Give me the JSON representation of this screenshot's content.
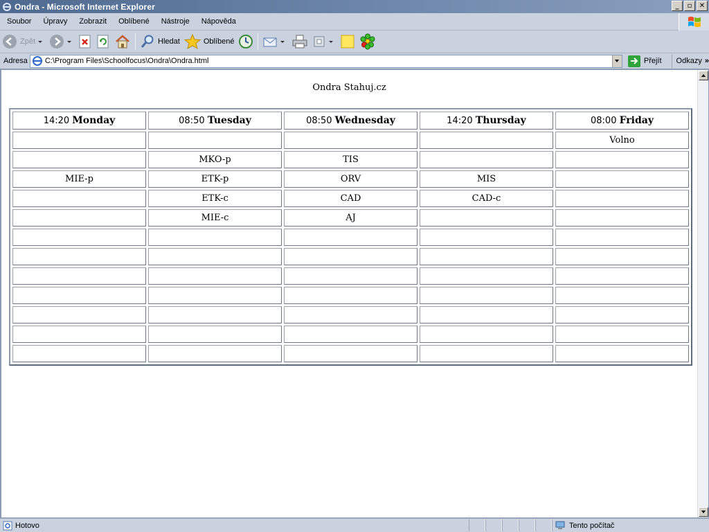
{
  "window": {
    "title": "Ondra - Microsoft Internet Explorer",
    "controls": {
      "minimize": "_",
      "maximize": "▫",
      "close": "✕"
    }
  },
  "menu": {
    "items": [
      "Soubor",
      "Úpravy",
      "Zobrazit",
      "Oblíbené",
      "Nástroje",
      "Nápověda"
    ]
  },
  "toolbar": {
    "back_label": "Zpět",
    "search_label": "Hledat",
    "favorites_label": "Oblíbené"
  },
  "address": {
    "label": "Adresa",
    "value": "C:\\Program Files\\Schoolfocus\\Ondra\\Ondra.html",
    "go_label": "Přejít",
    "links_label": "Odkazy",
    "chevron": "»"
  },
  "page": {
    "heading": "Ondra Stahuj.cz",
    "columns": [
      {
        "time": "14:20",
        "day": "Monday"
      },
      {
        "time": "08:50",
        "day": "Tuesday"
      },
      {
        "time": "08:50",
        "day": "Wednesday"
      },
      {
        "time": "14:20",
        "day": "Thursday"
      },
      {
        "time": "08:00",
        "day": "Friday"
      }
    ],
    "rows": [
      [
        "",
        "",
        "",
        "",
        "Volno"
      ],
      [
        "",
        "MKO-p",
        "TIS",
        "",
        ""
      ],
      [
        "MIE-p",
        "ETK-p",
        "ORV",
        "MIS",
        ""
      ],
      [
        "",
        "ETK-c",
        "CAD",
        "CAD-c",
        ""
      ],
      [
        "",
        "MIE-c",
        "AJ",
        "",
        ""
      ],
      [
        "",
        "",
        "",
        "",
        ""
      ],
      [
        "",
        "",
        "",
        "",
        ""
      ],
      [
        "",
        "",
        "",
        "",
        ""
      ],
      [
        "",
        "",
        "",
        "",
        ""
      ],
      [
        "",
        "",
        "",
        "",
        ""
      ],
      [
        "",
        "",
        "",
        "",
        ""
      ],
      [
        "",
        "",
        "",
        "",
        ""
      ]
    ]
  },
  "status": {
    "text": "Hotovo",
    "zone": "Tento počítač"
  },
  "colors": {
    "chrome": "#c9d2de",
    "titlebar": "#5d78a0",
    "go_green": "#2fa33a"
  }
}
